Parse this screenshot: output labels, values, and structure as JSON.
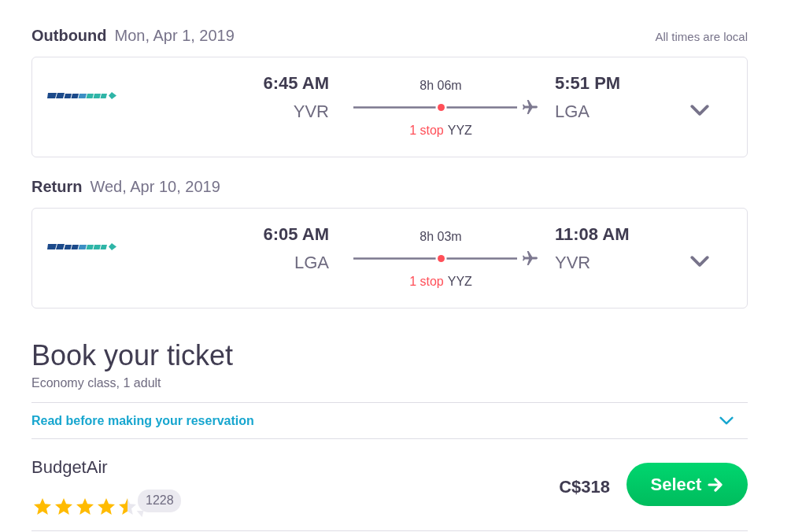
{
  "legs": [
    {
      "label": "Outbound",
      "date": "Mon, Apr 1, 2019",
      "departure": {
        "time": "6:45 AM",
        "airport": "YVR"
      },
      "duration": "8h 06m",
      "stops": "1 stop",
      "stop_airport": "YYZ",
      "arrival": {
        "time": "5:51 PM",
        "airport": "LGA"
      },
      "expanded": false
    },
    {
      "label": "Return",
      "date": "Wed, Apr 10, 2019",
      "departure": {
        "time": "6:05 AM",
        "airport": "LGA"
      },
      "duration": "8h 03m",
      "stops": "1 stop",
      "stop_airport": "YYZ",
      "arrival": {
        "time": "11:08 AM",
        "airport": "YVR"
      },
      "expanded": false
    }
  ],
  "timezone_note": "All times are local",
  "booking": {
    "title": "Book your ticket",
    "subtitle": "Economy class, 1 adult",
    "notice": {
      "label": "Read before making your reservation",
      "expanded": false
    },
    "offers": [
      {
        "provider": "BudgetAir",
        "stars": 4.5,
        "review_count": "1228",
        "price": "C$318",
        "action": "Select"
      }
    ]
  }
}
